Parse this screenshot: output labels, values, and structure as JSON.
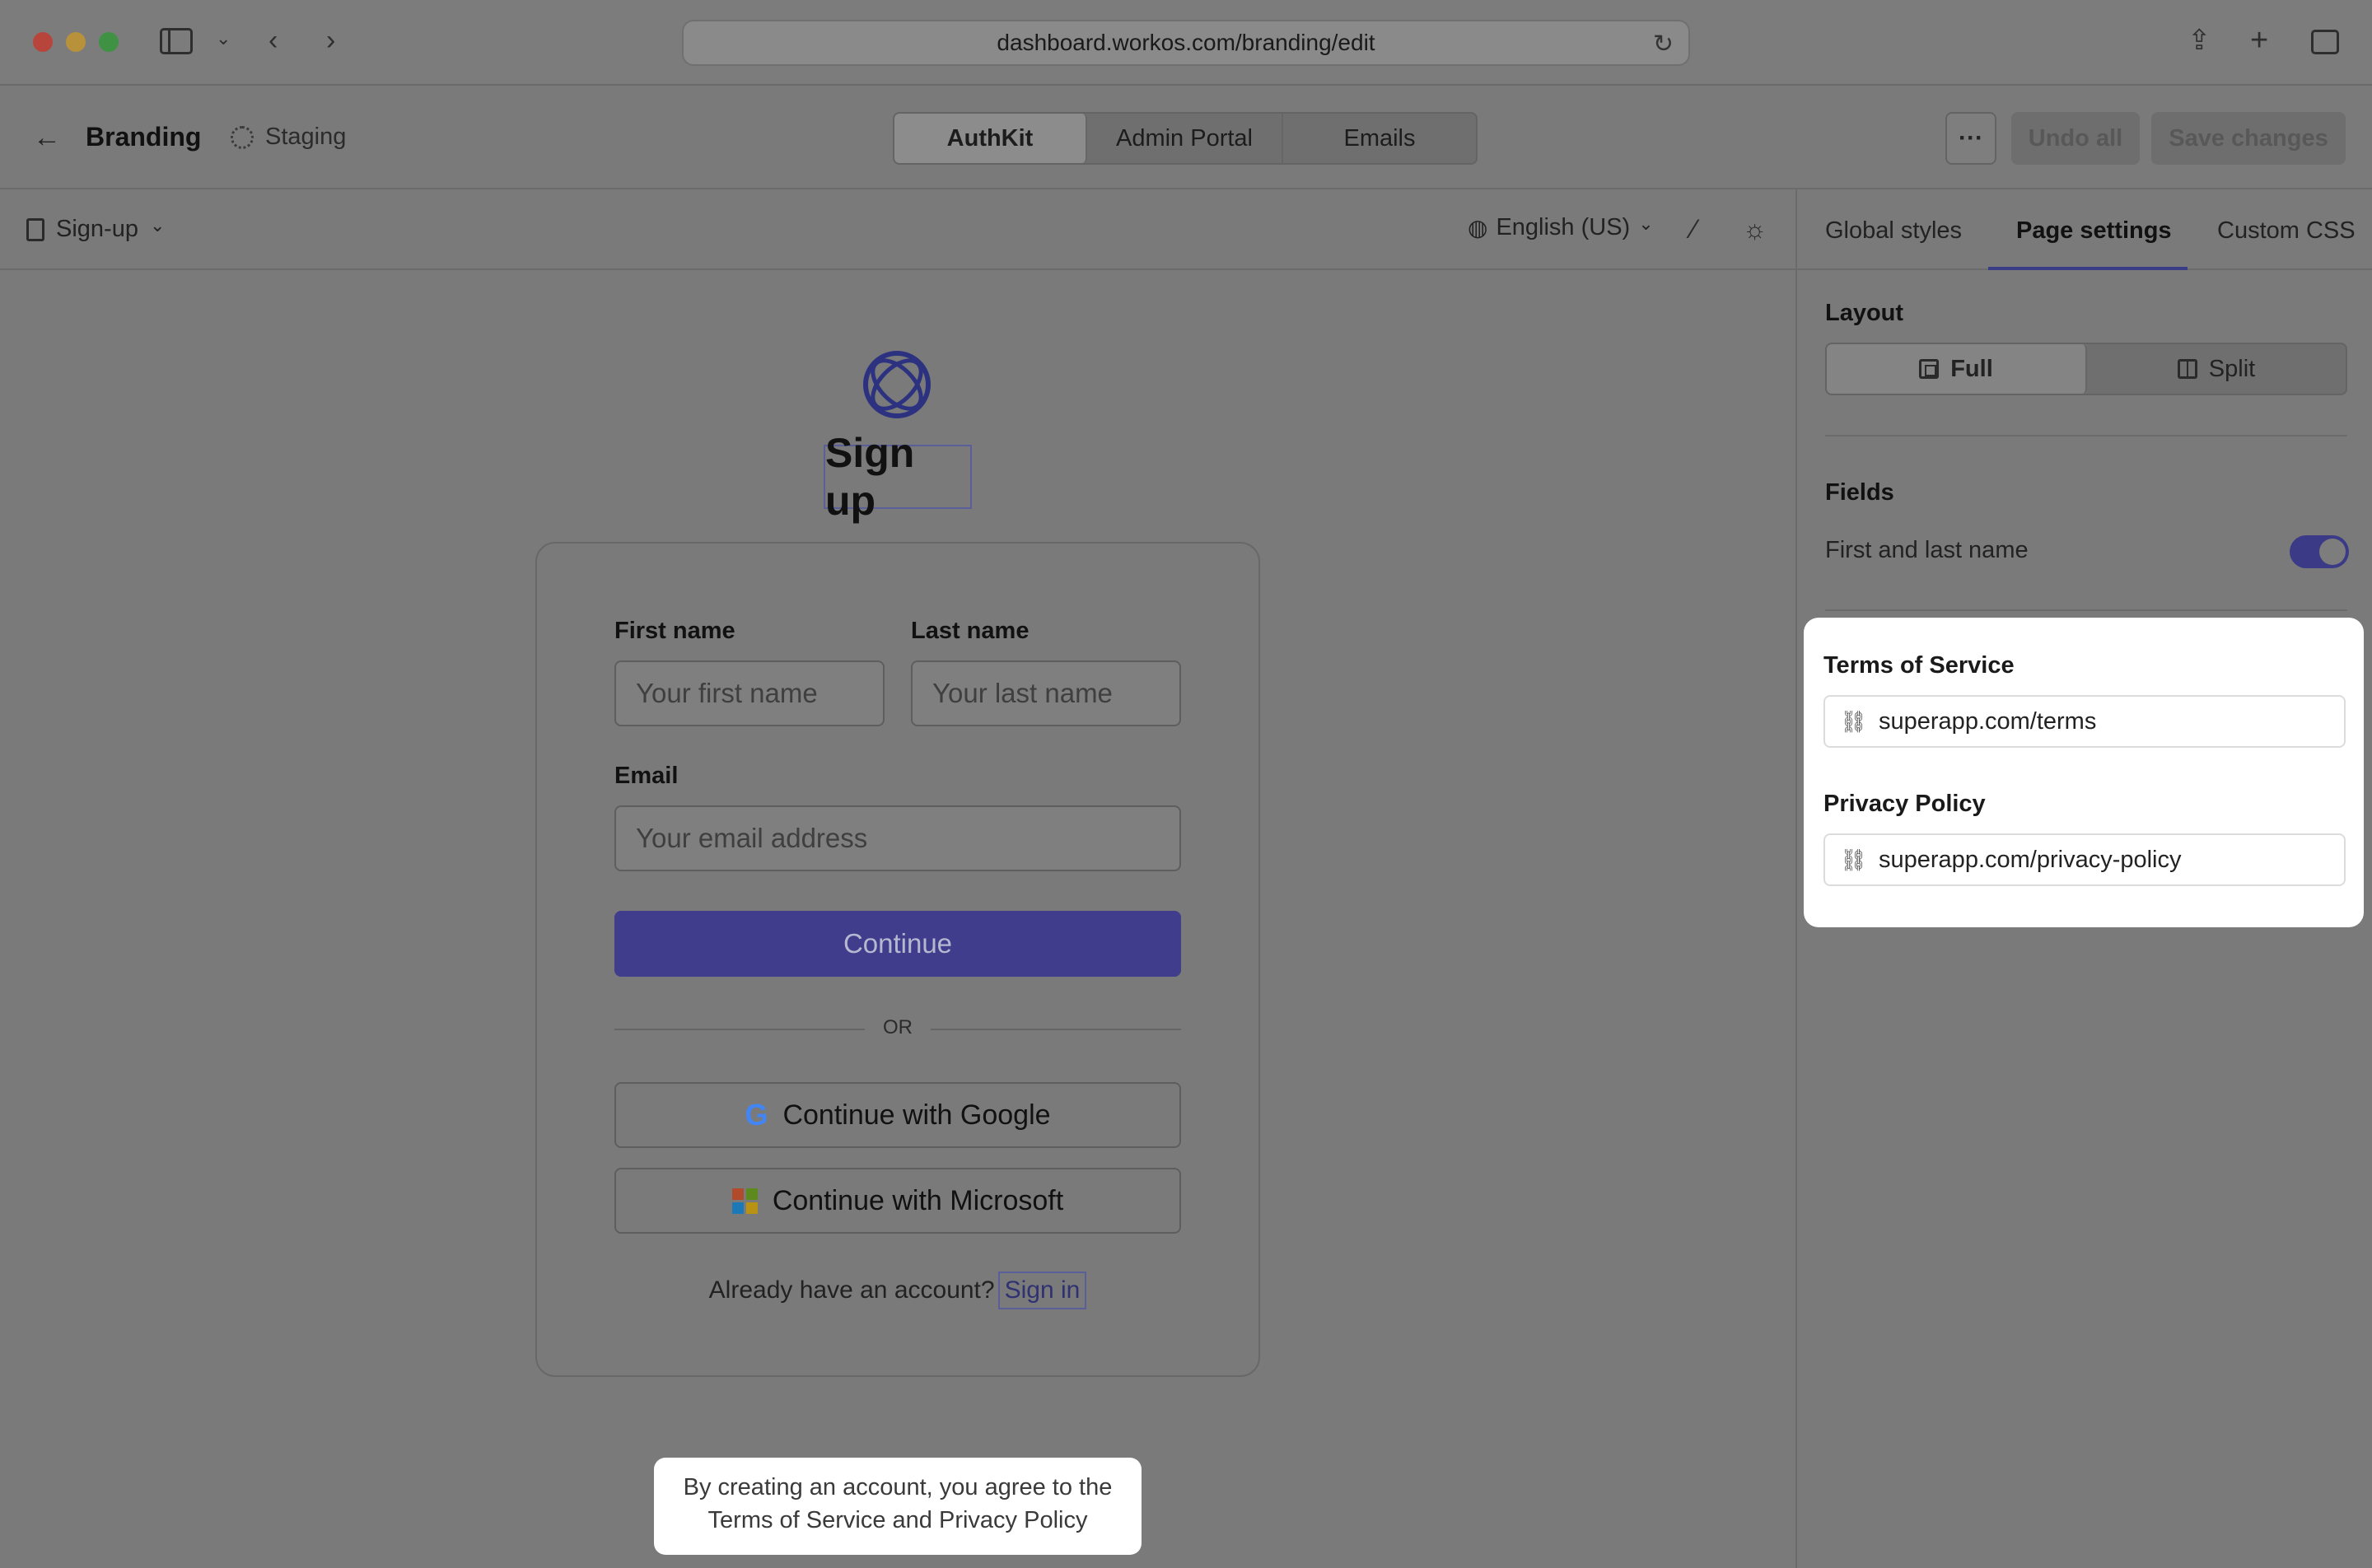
{
  "browser": {
    "url": "dashboard.workos.com/branding/edit",
    "icons": [
      "sidebar-icon",
      "chevron-down-icon",
      "back-icon",
      "forward-icon",
      "reload-icon",
      "share-icon",
      "new-tab-icon",
      "tabs-overview-icon"
    ]
  },
  "header": {
    "back_icon": "←",
    "title": "Branding",
    "environment": "Staging",
    "tabs": [
      {
        "label": "AuthKit",
        "active": true
      },
      {
        "label": "Admin Portal",
        "active": false
      },
      {
        "label": "Emails",
        "active": false
      }
    ],
    "more_label": "···",
    "undo_label": "Undo all",
    "save_label": "Save changes"
  },
  "toolbar": {
    "page": "Sign-up",
    "language": "English (US)",
    "chevron": "⌄"
  },
  "preview": {
    "heading": "Sign up",
    "first_name_label": "First name",
    "first_name_placeholder": "Your first name",
    "last_name_label": "Last name",
    "last_name_placeholder": "Your last name",
    "email_label": "Email",
    "email_placeholder": "Your email address",
    "continue_label": "Continue",
    "or_label": "OR",
    "google_label": "Continue with Google",
    "microsoft_label": "Continue with Microsoft",
    "account_prompt": "Already have an account?",
    "sign_in_label": "Sign in",
    "legal_line1": "By creating an account, you agree to the",
    "legal_line2": "Terms of Service and Privacy Policy",
    "accent_color": "#3f3d8c"
  },
  "panel": {
    "tabs": [
      {
        "label": "Global styles",
        "active": false
      },
      {
        "label": "Page settings",
        "active": true
      },
      {
        "label": "Custom CSS",
        "active": false
      }
    ],
    "layout_title": "Layout",
    "layout_options": [
      {
        "label": "Full",
        "selected": true
      },
      {
        "label": "Split",
        "selected": false
      }
    ],
    "fields_title": "Fields",
    "first_last_name_label": "First and last name",
    "first_last_name_enabled": true,
    "terms_title": "Terms of Service",
    "terms_value": "superapp.com/terms",
    "privacy_title": "Privacy Policy",
    "privacy_value": "superapp.com/privacy-policy"
  }
}
